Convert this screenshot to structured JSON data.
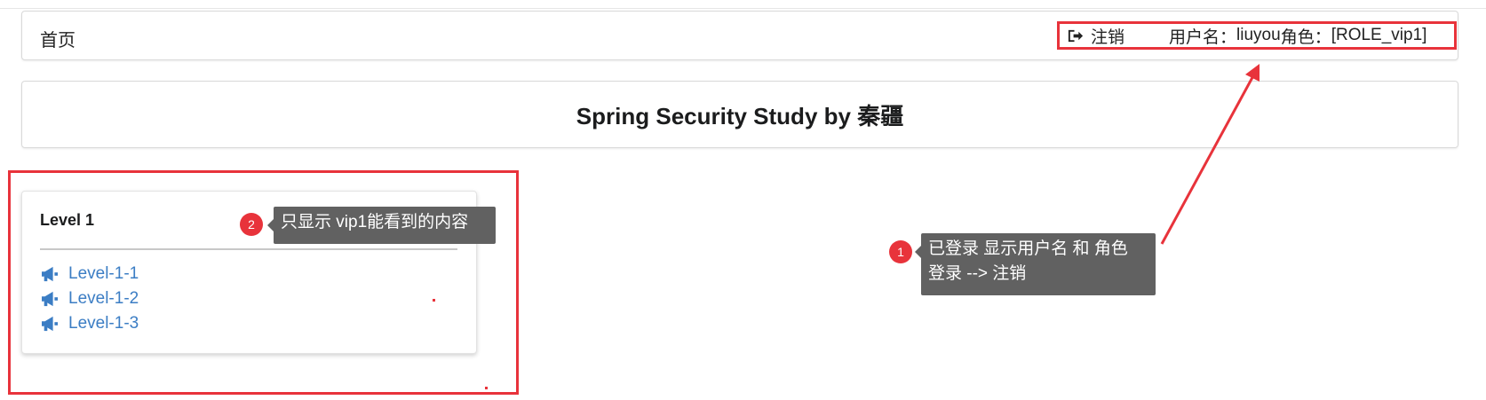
{
  "header": {
    "home_label": "首页",
    "logout_label": "注销",
    "user_label": "用户名：",
    "user_name": "liuyou",
    "role_label": "角色：",
    "role_value": "[ROLE_vip1]"
  },
  "title": "Spring Security Study by 秦疆",
  "card": {
    "title": "Level 1",
    "links": [
      "Level-1-1",
      "Level-1-2",
      "Level-1-3"
    ]
  },
  "annotations": [
    {
      "number": "1",
      "lines": [
        "已登录 显示用户名 和 角色",
        "登录 --> 注销"
      ]
    },
    {
      "number": "2",
      "text": "只显示 vip1能看到的内容"
    }
  ],
  "colors": {
    "highlight": "#e8333b",
    "link": "#3b7dc4",
    "tooltip_bg": "#616161"
  },
  "icons": {
    "logout": "sign-out-icon",
    "link": "bullhorn-icon"
  }
}
